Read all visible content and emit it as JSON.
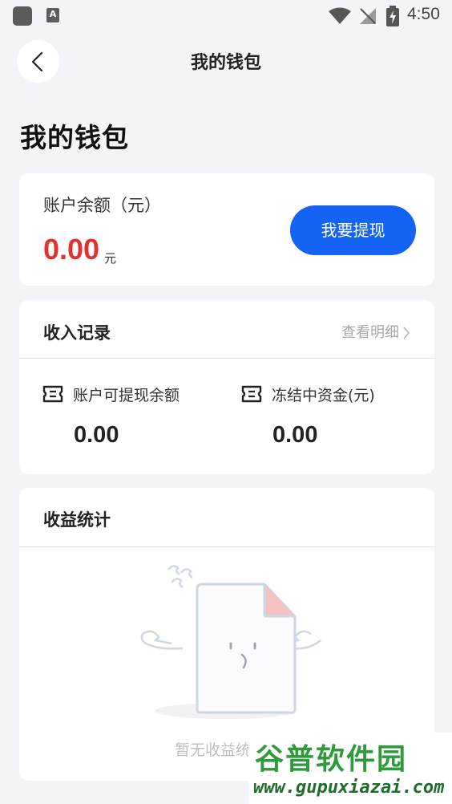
{
  "status_bar": {
    "time": "4:50",
    "a_badge": "A"
  },
  "header": {
    "title": "我的钱包"
  },
  "page_title": "我的钱包",
  "balance": {
    "label": "账户余额（元）",
    "value": "0.00",
    "unit": "元",
    "withdraw_label": "我要提现"
  },
  "income": {
    "title": "收入记录",
    "detail_link": "查看明细",
    "stats": [
      {
        "label": "账户可提现余额",
        "value": "0.00"
      },
      {
        "label": "冻结中资金(元)",
        "value": "0.00"
      }
    ]
  },
  "profit": {
    "title": "收益统计",
    "empty_text": "暂无收益统计"
  },
  "watermark": {
    "title": "谷普软件园",
    "url": "www.gupuxiazai.com"
  },
  "colors": {
    "accent": "#1463f5",
    "amount": "#e0332f",
    "background": "#f3f4f7"
  }
}
